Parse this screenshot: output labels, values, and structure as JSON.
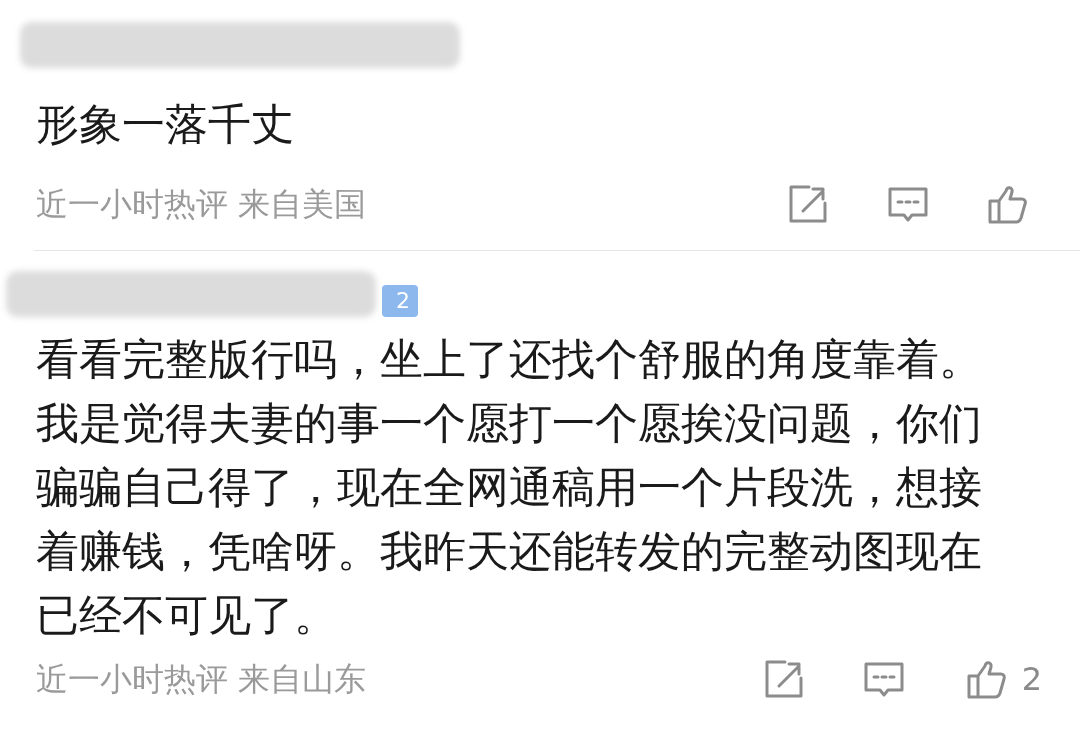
{
  "comments": [
    {
      "body": "形象一落千丈",
      "meta": "近一小时热评 来自美国"
    },
    {
      "badge": "2",
      "body": "看看完整版行吗，坐上了还找个舒服的角度靠着。我是觉得夫妻的事一个愿打一个愿挨没问题，你们骗骗自己得了，现在全网通稿用一个片段洗，想接着赚钱，凭啥呀。我昨天还能转发的完整动图现在已经不可见了。",
      "meta": "近一小时热评 来自山东",
      "likes": "2"
    }
  ]
}
